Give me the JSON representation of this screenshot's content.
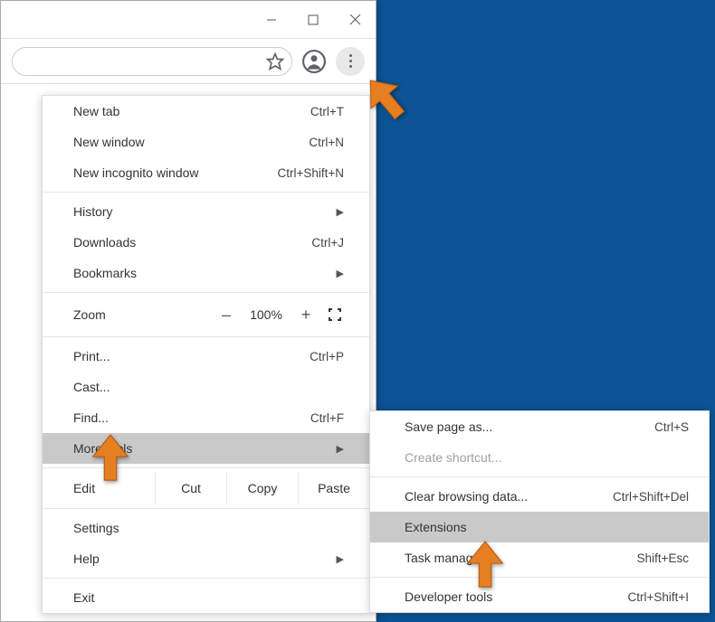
{
  "menu": {
    "group1": [
      {
        "label": "New tab",
        "shortcut": "Ctrl+T"
      },
      {
        "label": "New window",
        "shortcut": "Ctrl+N"
      },
      {
        "label": "New incognito window",
        "shortcut": "Ctrl+Shift+N"
      }
    ],
    "group2": [
      {
        "label": "History",
        "arrow": true
      },
      {
        "label": "Downloads",
        "shortcut": "Ctrl+J"
      },
      {
        "label": "Bookmarks",
        "arrow": true
      }
    ],
    "zoom": {
      "label": "Zoom",
      "minus": "–",
      "value": "100%",
      "plus": "+"
    },
    "group3": [
      {
        "label": "Print...",
        "shortcut": "Ctrl+P"
      },
      {
        "label": "Cast..."
      },
      {
        "label": "Find...",
        "shortcut": "Ctrl+F"
      },
      {
        "label": "More tools",
        "arrow": true,
        "highlighted": true
      }
    ],
    "edit": {
      "label": "Edit",
      "cut": "Cut",
      "copy": "Copy",
      "paste": "Paste"
    },
    "group4": [
      {
        "label": "Settings"
      },
      {
        "label": "Help",
        "arrow": true
      }
    ],
    "group5": [
      {
        "label": "Exit"
      }
    ]
  },
  "submenu": {
    "group1": [
      {
        "label": "Save page as...",
        "shortcut": "Ctrl+S"
      },
      {
        "label": "Create shortcut...",
        "disabled": true
      }
    ],
    "group2": [
      {
        "label": "Clear browsing data...",
        "shortcut": "Ctrl+Shift+Del"
      },
      {
        "label": "Extensions",
        "highlighted": true
      },
      {
        "label": "Task manager",
        "shortcut": "Shift+Esc"
      }
    ],
    "group3": [
      {
        "label": "Developer tools",
        "shortcut": "Ctrl+Shift+I"
      }
    ]
  }
}
